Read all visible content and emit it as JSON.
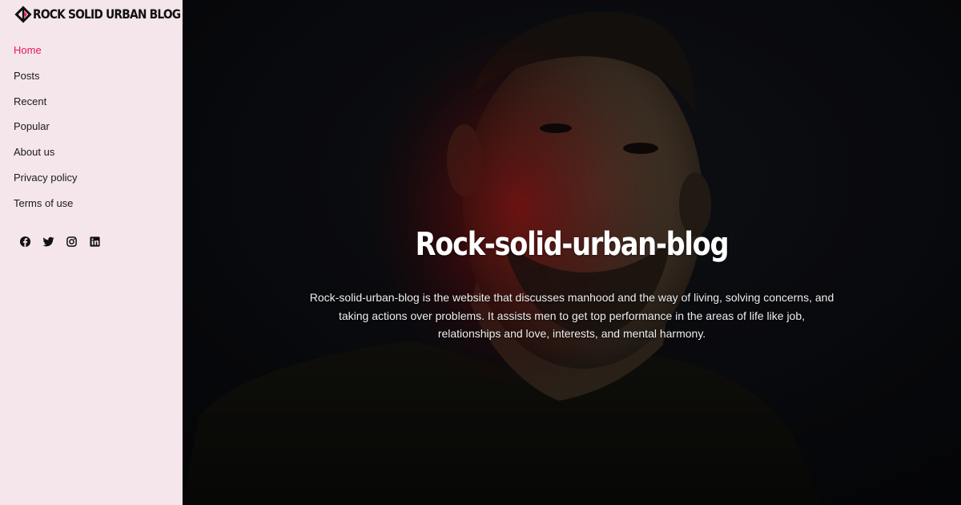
{
  "brand": {
    "logo_text": "ROCK SOLID URBAN BLOG",
    "accent_color": "#e8175d"
  },
  "nav": {
    "items": [
      {
        "label": "Home",
        "active": true
      },
      {
        "label": "Posts"
      },
      {
        "label": "Recent"
      },
      {
        "label": "Popular"
      },
      {
        "label": "About us"
      },
      {
        "label": "Privacy policy"
      },
      {
        "label": "Terms of use"
      }
    ]
  },
  "socials": [
    {
      "icon": "facebook-icon"
    },
    {
      "icon": "twitter-icon"
    },
    {
      "icon": "instagram-icon"
    },
    {
      "icon": "linkedin-icon"
    }
  ],
  "hero": {
    "title": "Rock-solid-urban-blog",
    "description": "Rock-solid-urban-blog is the website that discusses manhood and the way of living, solving concerns, and taking actions over problems. It assists men to get top performance in the areas of life like job, relationships and love, interests, and mental harmony."
  }
}
